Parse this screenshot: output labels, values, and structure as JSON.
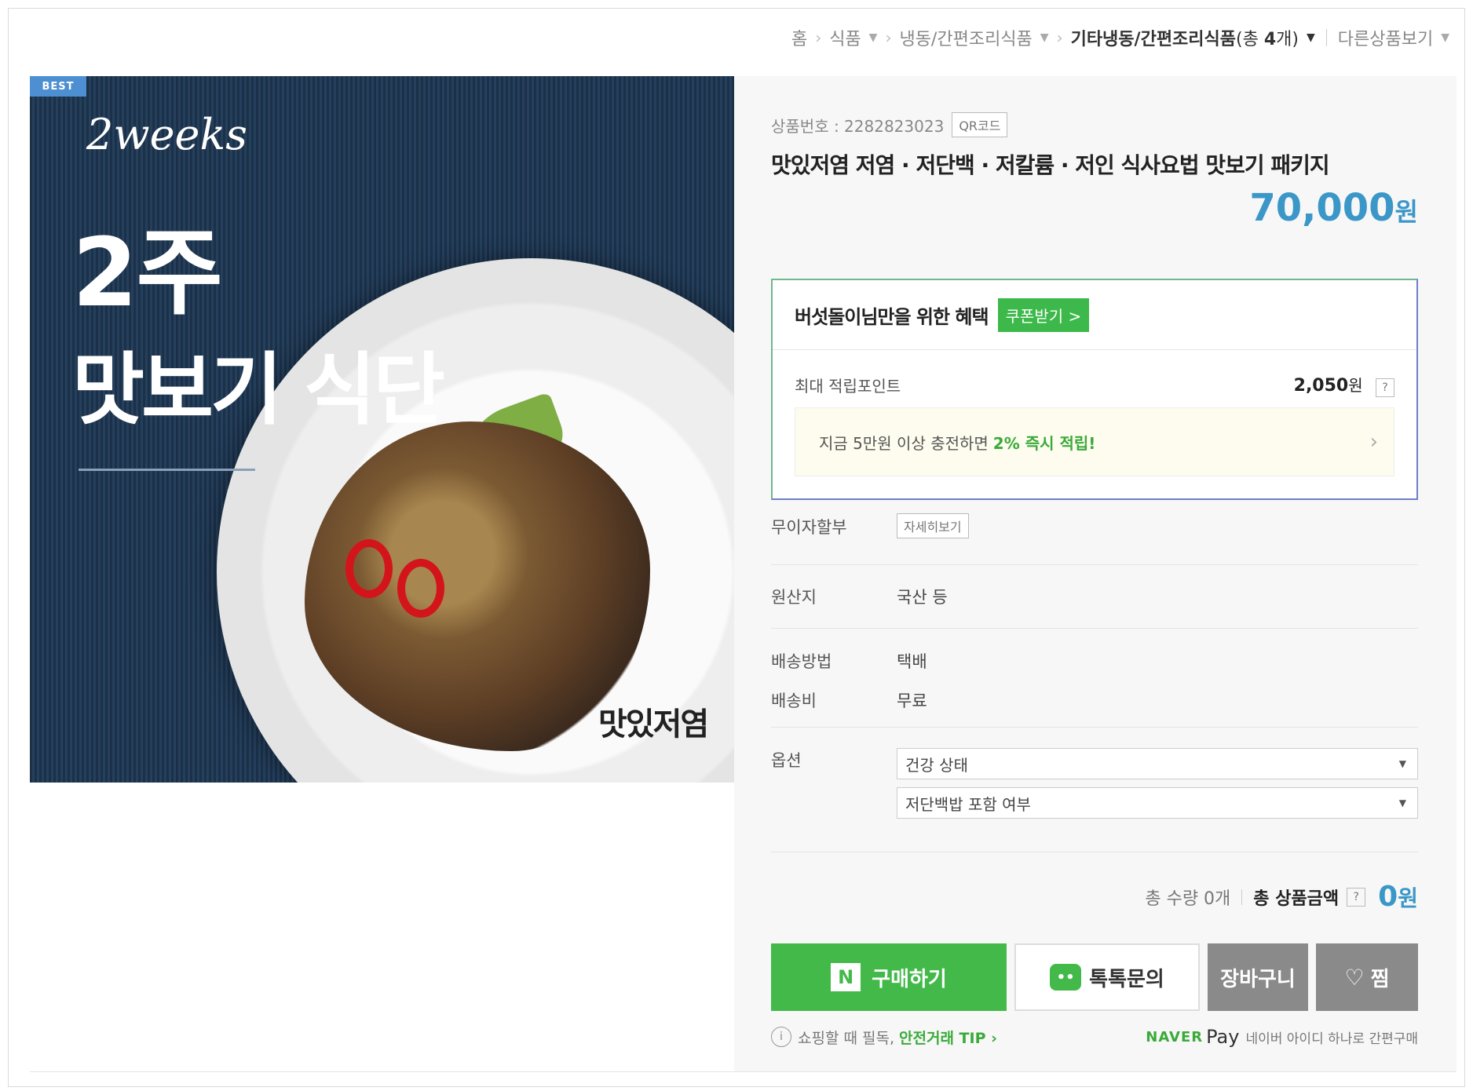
{
  "breadcrumb": {
    "home": "홈",
    "cat1": "식품",
    "cat2": "냉동/간편조리식품",
    "cat3_name": "기타냉동/간편조리식품",
    "cat3_count_prefix": "(총 ",
    "cat3_count": "4",
    "cat3_count_suffix": "개)",
    "more": "다른상품보기"
  },
  "photo": {
    "badge": "BEST",
    "brand_script": "2weeks",
    "headline1": "2주",
    "headline2": "맛보기 식단",
    "logo": "맛있저염"
  },
  "product": {
    "number_label": "상품번호 : 2282823023",
    "qr_label": "QR코드",
    "name": "맛있저염 저염 · 저단백 · 저칼륨 · 저인 식사요법 맛보기 패키지",
    "price": "70,000",
    "price_unit": "원",
    "price_color": "#3b97c8"
  },
  "benefit": {
    "title": "버섯돌이님만을 위한 혜택",
    "coupon_label": "쿠폰받기 >",
    "point_label": "최대 적립포인트",
    "point_value": "2,050",
    "point_unit": "원",
    "help": "?",
    "charge_text": "지금 5만원 이상 충전하면",
    "charge_highlight": "2% 즉시 적립!",
    "chevron": "›"
  },
  "details": {
    "installment_label": "무이자할부",
    "installment_button": "자세히보기",
    "origin_label": "원산지",
    "origin_value": "국산 등",
    "shipping_method_label": "배송방법",
    "shipping_method_value": "택배",
    "shipping_fee_label": "배송비",
    "shipping_fee_value": "무료",
    "option_label": "옵션",
    "option1": "건강 상태",
    "option2": "저단백밥 포함 여부"
  },
  "summary": {
    "qty_text": "총 수량 0개",
    "amount_label": "총 상품금액",
    "help": "?",
    "amount_value": "0",
    "amount_unit": "원"
  },
  "buttons": {
    "buy_n": "N",
    "buy": "구매하기",
    "talk": "톡톡문의",
    "cart": "장바구니",
    "wish": "찜"
  },
  "footer": {
    "info_icon": "i",
    "notice": "쇼핑할 때 필독,",
    "tip": "안전거래 TIP ›",
    "naver": "NAVER",
    "pay": "Pay",
    "pay_desc": "네이버 아이디 하나로 간편구매"
  },
  "colors": {
    "brand_green": "#43b94a",
    "price_blue": "#3b97c8",
    "gray_button": "#8a8a8a"
  }
}
